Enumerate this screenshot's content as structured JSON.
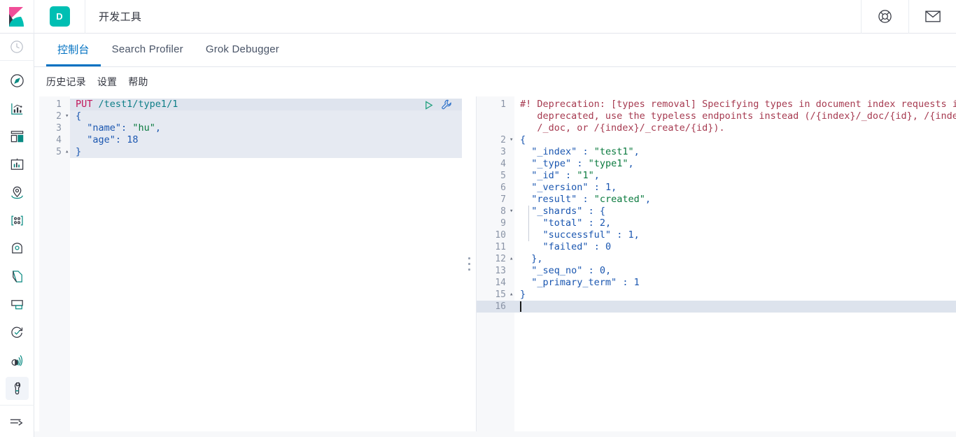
{
  "header": {
    "logo_icon": "kibana-logo-icon",
    "space_badge": "D",
    "title": "开发工具",
    "help_icon": "lifebuoy-help-icon",
    "mail_icon": "envelope-icon"
  },
  "rail": {
    "recent_icon": "clock-recently-viewed-icon",
    "items": [
      {
        "icon": "compass-discover-icon",
        "label": "Discover"
      },
      {
        "icon": "bar-chart-visualize-icon",
        "label": "Visualize"
      },
      {
        "icon": "dashboard-icon",
        "label": "Dashboard"
      },
      {
        "icon": "canvas-icon",
        "label": "Canvas"
      },
      {
        "icon": "map-pin-maps-icon",
        "label": "Maps"
      },
      {
        "icon": "machine-learning-icon",
        "label": "Machine Learning"
      },
      {
        "icon": "infrastructure-icon",
        "label": "Infrastructure"
      },
      {
        "icon": "logs-icon",
        "label": "Logs"
      },
      {
        "icon": "apm-icon",
        "label": "APM"
      },
      {
        "icon": "uptime-icon",
        "label": "Uptime"
      },
      {
        "icon": "siem-radar-icon",
        "label": "SIEM"
      },
      {
        "icon": "wrench-dev-tools-icon",
        "label": "Dev Tools"
      }
    ],
    "collapse_icon": "collapse-arrow-icon"
  },
  "tabs": [
    {
      "label": "控制台",
      "active": true
    },
    {
      "label": "Search Profiler",
      "active": false
    },
    {
      "label": "Grok Debugger",
      "active": false
    }
  ],
  "submenu": [
    {
      "label": "历史记录"
    },
    {
      "label": "设置"
    },
    {
      "label": "帮助"
    }
  ],
  "request_editor": {
    "play_icon": "play-run-request-icon",
    "wrench_icon": "wrench-request-options-icon",
    "lines": [
      {
        "n": "1",
        "fold": "",
        "text": "PUT /test1/type1/1"
      },
      {
        "n": "2",
        "fold": "▾",
        "text": "{"
      },
      {
        "n": "3",
        "fold": "",
        "text": "  \"name\": \"hu\","
      },
      {
        "n": "4",
        "fold": "",
        "text": "  \"age\": 18"
      },
      {
        "n": "5",
        "fold": "▴",
        "text": "}"
      }
    ]
  },
  "response_editor": {
    "lines": [
      {
        "n": "1",
        "fold": "",
        "text": "#! Deprecation: [types removal] Specifying types in document index requests is"
      },
      {
        "n": "",
        "fold": "",
        "text": "   deprecated, use the typeless endpoints instead (/{index}/_doc/{id}, /{index}"
      },
      {
        "n": "",
        "fold": "",
        "text": "   /_doc, or /{index}/_create/{id})."
      },
      {
        "n": "2",
        "fold": "▾",
        "text": "{"
      },
      {
        "n": "3",
        "fold": "",
        "text": "  \"_index\" : \"test1\","
      },
      {
        "n": "4",
        "fold": "",
        "text": "  \"_type\" : \"type1\","
      },
      {
        "n": "5",
        "fold": "",
        "text": "  \"_id\" : \"1\","
      },
      {
        "n": "6",
        "fold": "",
        "text": "  \"_version\" : 1,"
      },
      {
        "n": "7",
        "fold": "",
        "text": "  \"result\" : \"created\","
      },
      {
        "n": "8",
        "fold": "▾",
        "text": "  \"_shards\" : {"
      },
      {
        "n": "9",
        "fold": "",
        "text": "    \"total\" : 2,"
      },
      {
        "n": "10",
        "fold": "",
        "text": "    \"successful\" : 1,"
      },
      {
        "n": "11",
        "fold": "",
        "text": "    \"failed\" : 0"
      },
      {
        "n": "12",
        "fold": "▴",
        "text": "  },"
      },
      {
        "n": "13",
        "fold": "",
        "text": "  \"_seq_no\" : 0,"
      },
      {
        "n": "14",
        "fold": "",
        "text": "  \"_primary_term\" : 1"
      },
      {
        "n": "15",
        "fold": "▴",
        "text": "}"
      },
      {
        "n": "16",
        "fold": "",
        "text": ""
      }
    ]
  },
  "colors": {
    "accent_blue": "#0071c2",
    "teal": "#00bfb3",
    "pink": "#f04e98",
    "navy": "#343741",
    "method": "#c2185b",
    "string": "#0a7a3e",
    "key": "#1a56b0",
    "deprecation": "#a63a50",
    "selection": "#e6eaf2"
  }
}
